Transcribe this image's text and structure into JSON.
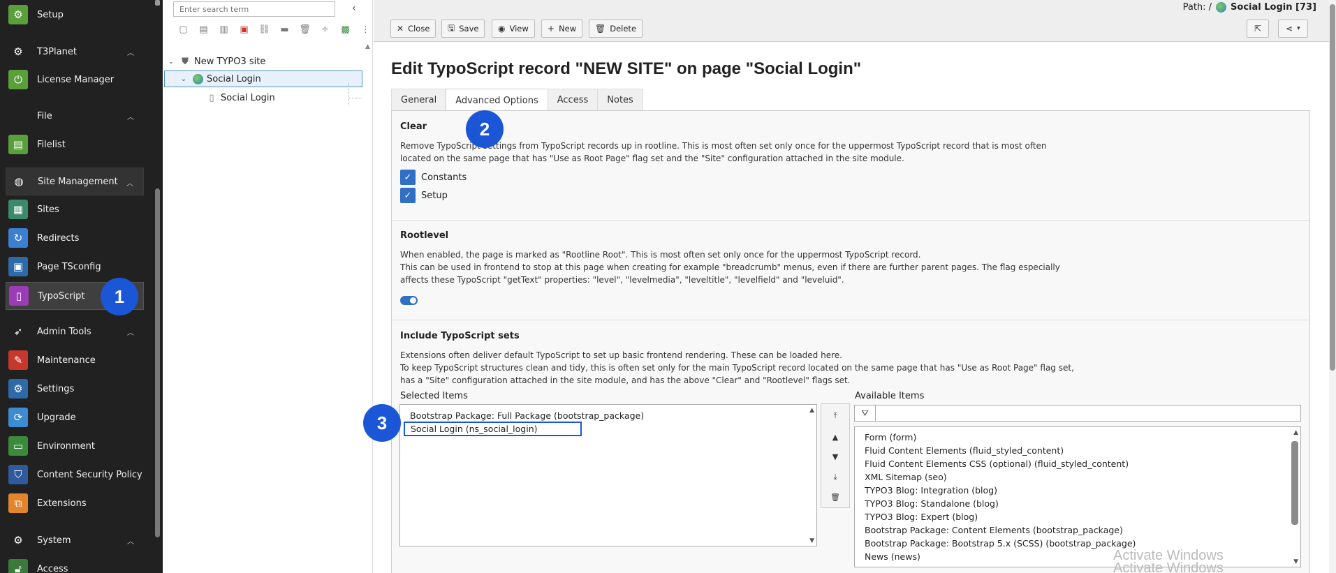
{
  "modmenu": {
    "items": [
      {
        "label": "Setup",
        "icon": "gear-icon",
        "color": "#5a9f3b",
        "kind": "item"
      },
      {
        "label": "T3Planet",
        "icon": "gear-icon",
        "kind": "group"
      },
      {
        "label": "License Manager",
        "icon": "power-icon",
        "color": "#5a9f3b",
        "kind": "item"
      },
      {
        "label": "File",
        "icon": "",
        "kind": "group"
      },
      {
        "label": "Filelist",
        "icon": "folder-icon",
        "color": "#5a9f3b",
        "kind": "item"
      },
      {
        "label": "Site Management",
        "icon": "globe-icon",
        "kind": "group"
      },
      {
        "label": "Sites",
        "icon": "sites-icon",
        "color": "#3c8a6b",
        "kind": "item"
      },
      {
        "label": "Redirects",
        "icon": "redirect-icon",
        "color": "#3d7fd0",
        "kind": "item"
      },
      {
        "label": "Page TSconfig",
        "icon": "tsconfig-icon",
        "color": "#2f6aa8",
        "kind": "item"
      },
      {
        "label": "TypoScript",
        "icon": "typoscript-icon",
        "color": "#9b3cb7",
        "kind": "item"
      },
      {
        "label": "Admin Tools",
        "icon": "rocket-icon",
        "kind": "group"
      },
      {
        "label": "Maintenance",
        "icon": "wrench-icon",
        "color": "#c8372c",
        "kind": "item"
      },
      {
        "label": "Settings",
        "icon": "gear-icon",
        "color": "#2f6aa8",
        "kind": "item"
      },
      {
        "label": "Upgrade",
        "icon": "upgrade-icon",
        "color": "#3d8bd0",
        "kind": "item"
      },
      {
        "label": "Environment",
        "icon": "environment-icon",
        "color": "#3c8a3b",
        "kind": "item"
      },
      {
        "label": "Content Security Policy",
        "icon": "shield-icon",
        "color": "#2f5a9b",
        "kind": "item"
      },
      {
        "label": "Extensions",
        "icon": "extensions-icon",
        "color": "#e2852b",
        "kind": "item"
      },
      {
        "label": "System",
        "icon": "gear-icon",
        "kind": "group"
      },
      {
        "label": "Access",
        "icon": "lock-icon",
        "color": "#3c7a3b",
        "kind": "item"
      }
    ]
  },
  "tree": {
    "search_placeholder": "Enter search term",
    "nodes": [
      {
        "label": "New TYPO3 site"
      },
      {
        "label": "Social Login"
      },
      {
        "label": "Social Login"
      }
    ]
  },
  "header": {
    "buttons": {
      "close": "Close",
      "save": "Save",
      "view": "View",
      "new": "New",
      "delete": "Delete"
    },
    "path_label": "Path: /",
    "path_page": "Social Login [73]"
  },
  "main": {
    "title": "Edit TypoScript record \"NEW SITE\" on page \"Social Login\"",
    "tabs": [
      "General",
      "Advanced Options",
      "Access",
      "Notes"
    ],
    "clear": {
      "title": "Clear",
      "desc1": "Remove TypoScript settings from TypoScript records up in rootline. This is most often set only once for the uppermost TypoScript record that is most often",
      "desc2": "located on the same page that has \"Use as Root Page\" flag set and the \"Site\" configuration attached in the site module.",
      "constants": "Constants",
      "setup": "Setup"
    },
    "rootlevel": {
      "title": "Rootlevel",
      "desc1": "When enabled, the page is marked as \"Rootline Root\". This is most often set only once for the uppermost TypoScript record.",
      "desc2": "This can be used in frontend to stop at this page when creating for example \"breadcrumb\" menus, even if there are further parent pages. The flag especially",
      "desc3": "affects these TypoScript \"getText\" properties: \"level\", \"levelmedia\", \"leveltitle\", \"levelfield\" and \"leveluid\"."
    },
    "include": {
      "title": "Include TypoScript sets",
      "desc1": "Extensions often deliver default TypoScript to set up basic frontend rendering. These can be loaded here.",
      "desc2": "To keep TypoScript structures clean and tidy, this is often set only for the main TypoScript record located on the same page that has \"Use as Root Page\" flag set,",
      "desc3": "has a \"Site\" configuration attached in the site module, and has the above \"Clear\" and \"Rootlevel\" flags set.",
      "selected_label": "Selected Items",
      "available_label": "Available Items",
      "selected": [
        "Bootstrap Package: Full Package (bootstrap_package)",
        "Social Login (ns_social_login)"
      ],
      "available": [
        "Form (form)",
        "Fluid Content Elements (fluid_styled_content)",
        "Fluid Content Elements CSS (optional) (fluid_styled_content)",
        "XML Sitemap (seo)",
        "TYPO3 Blog: Integration (blog)",
        "TYPO3 Blog: Standalone (blog)",
        "TYPO3 Blog: Expert (blog)",
        "Bootstrap Package: Content Elements (bootstrap_package)",
        "Bootstrap Package: Bootstrap 5.x (SCSS) (bootstrap_package)",
        "News (news)"
      ]
    }
  },
  "badges": [
    "1",
    "2",
    "3"
  ],
  "watermark": [
    "Activate Windows",
    "Activate Windows"
  ],
  "colors": {
    "accent": "#1a56d6",
    "checkbox": "#2f6fc6"
  }
}
